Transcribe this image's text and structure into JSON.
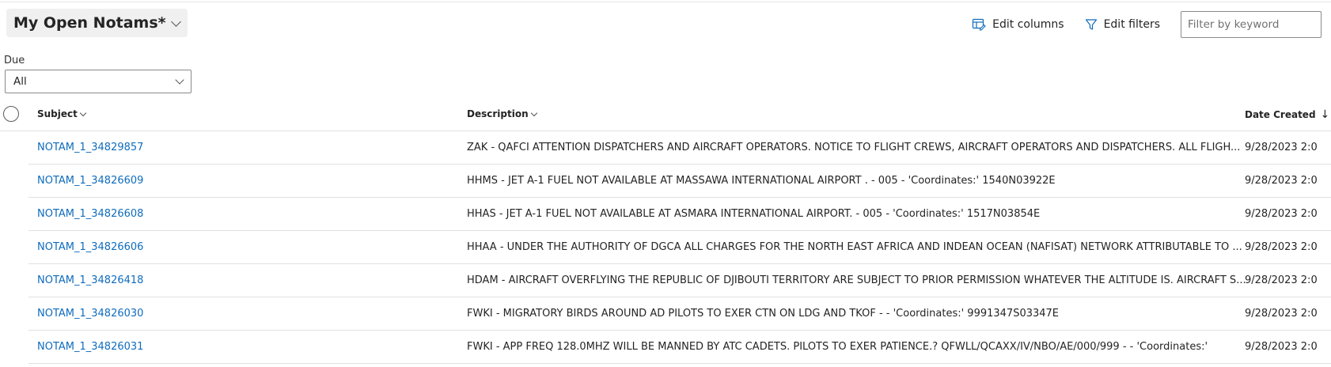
{
  "view": {
    "title": "My Open Notams*"
  },
  "toolbar": {
    "edit_columns": "Edit columns",
    "edit_filters": "Edit filters",
    "search_placeholder": "Filter by keyword"
  },
  "filter": {
    "label": "Due",
    "value": "All"
  },
  "columns": {
    "subject": "Subject",
    "description": "Description",
    "date_created": "Date Created"
  },
  "rows": [
    {
      "subject": "NOTAM_1_34829857",
      "description": "ZAK - QAFCI ATTENTION DISPATCHERS AND AIRCRAFT OPERATORS.   NOTICE TO FLIGHT CREWS, AIRCRAFT OPERATORS AND DISPATCHERS. ALL  FLIGH...",
      "date": "9/28/2023 2:0"
    },
    {
      "subject": "NOTAM_1_34826609",
      "description": "HHMS - JET A-1 FUEL NOT AVAILABLE AT MASSAWA INTERNATIONAL AIRPORT . - 005 - 'Coordinates:' 1540N03922E",
      "date": "9/28/2023 2:0"
    },
    {
      "subject": "NOTAM_1_34826608",
      "description": "HHAS - JET A-1 FUEL NOT AVAILABLE AT ASMARA INTERNATIONAL AIRPORT. - 005 - 'Coordinates:' 1517N03854E",
      "date": "9/28/2023 2:0"
    },
    {
      "subject": "NOTAM_1_34826606",
      "description": "HHAA - UNDER THE AUTHORITY OF DGCA ALL CHARGES FOR THE NORTH EAST AFRICA AND INDEAN OCEAN (NAFISAT) NETWORK ATTRIBUTABLE TO ...",
      "date": "9/28/2023 2:0"
    },
    {
      "subject": "NOTAM_1_34826418",
      "description": "HDAM - AIRCRAFT OVERFLYING THE REPUBLIC OF DJIBOUTI TERRITORY ARE SUBJECT  TO PRIOR PERMISSION WHATEVER THE ALTITUDE IS. AIRCRAFT S...",
      "date": "9/28/2023 2:0"
    },
    {
      "subject": "NOTAM_1_34826030",
      "description": "FWKI - MIGRATORY BIRDS AROUND AD PILOTS TO EXER CTN ON LDG AND TKOF -  - 'Coordinates:' 9991347S03347E",
      "date": "9/28/2023 2:0"
    },
    {
      "subject": "NOTAM_1_34826031",
      "description": "FWKI - APP FREQ 128.0MHZ WILL BE MANNED BY ATC CADETS. PILOTS TO EXER        PATIENCE.? QFWLL/QCAXX/IV/NBO/AE/000/999 -  - 'Coordinates:'",
      "date": "9/28/2023 2:0"
    }
  ]
}
